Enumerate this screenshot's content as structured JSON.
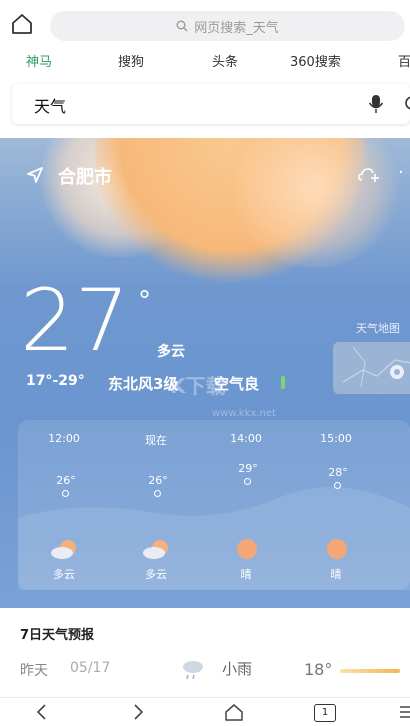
{
  "browser": {
    "search_placeholder": "网页搜索_天气"
  },
  "engines": [
    "神马",
    "搜狗",
    "头条",
    "360搜索",
    "百"
  ],
  "search": {
    "query": "天气"
  },
  "weather": {
    "city": "合肥市",
    "temperature": "27",
    "degree_symbol": "°",
    "condition": "多云",
    "range": "17°-29°",
    "wind": "东北风3级",
    "air_quality": "空气良",
    "map_label": "天气地图",
    "watermark": "K下载",
    "watermark_url": "www.kkx.net"
  },
  "hourly": [
    {
      "time": "12:00",
      "temp": "26°",
      "condition": "多云",
      "icon": "cloudy-sun-icon"
    },
    {
      "time": "现在",
      "temp": "26°",
      "condition": "多云",
      "icon": "cloudy-sun-icon"
    },
    {
      "time": "14:00",
      "temp": "29°",
      "condition": "晴",
      "icon": "sun-icon"
    },
    {
      "time": "15:00",
      "temp": "28°",
      "condition": "晴",
      "icon": "sun-icon"
    }
  ],
  "forecast": {
    "title": "7日天气预报",
    "rows": [
      {
        "day": "昨天",
        "date": "05/17",
        "condition": "小雨",
        "low": "18°",
        "icon": "rain-cloud-icon"
      }
    ]
  },
  "nav": {
    "tab_count": "1"
  },
  "colors": {
    "accent": "#2e9e61",
    "sky_top": "#9fb9d8",
    "sky_main": "#6f98cf",
    "sun": "#f7b97a"
  }
}
